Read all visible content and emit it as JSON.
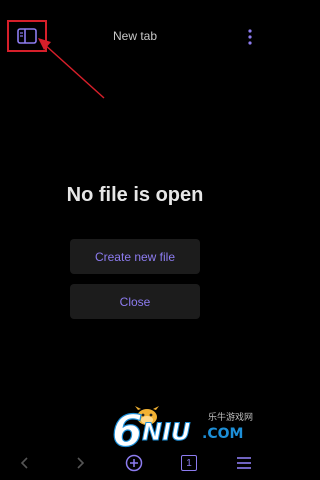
{
  "header": {
    "title": "New tab"
  },
  "empty_state": {
    "title": "No file is open",
    "create_label": "Create new file",
    "close_label": "Close"
  },
  "bottom_nav": {
    "tab_count": "1"
  },
  "watermark": {
    "big_digit": "6",
    "brand": "NIU",
    "domain": ".COM",
    "cn_text": "乐牛游戏网"
  },
  "colors": {
    "background": "#000000",
    "accent": "#8d7cf0",
    "annotation": "#d61f2a",
    "button_bg": "#1c1c1c"
  }
}
